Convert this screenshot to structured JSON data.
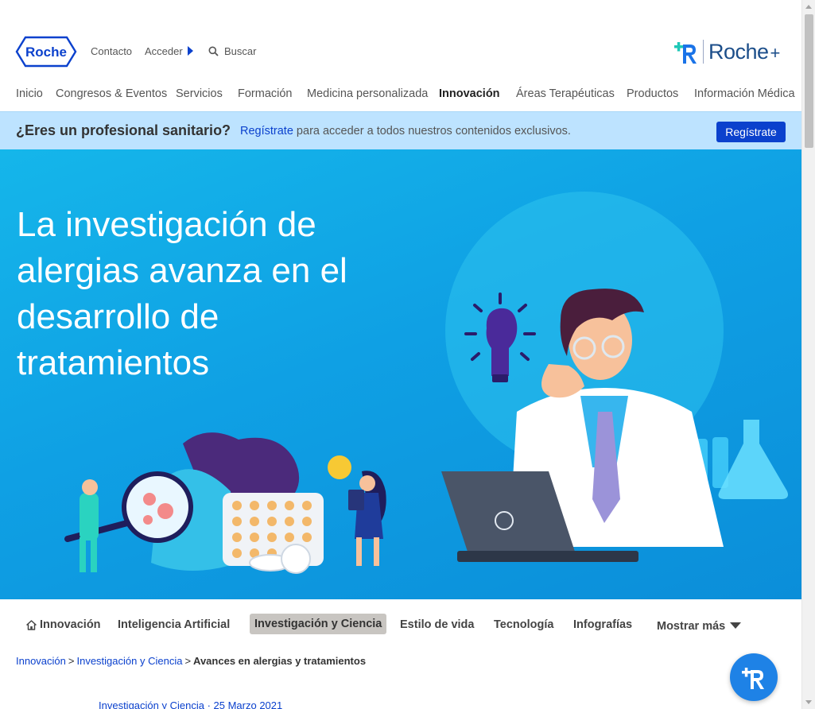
{
  "header": {
    "logo_text": "Roche",
    "contacto": "Contacto",
    "acceder": "Acceder",
    "search_label": "Buscar",
    "rocheplus_word": "Roche",
    "rocheplus_plus": "+"
  },
  "nav": {
    "items": [
      {
        "label": "Inicio",
        "active": false
      },
      {
        "label": "Congresos & Eventos",
        "active": false
      },
      {
        "label": "Servicios",
        "active": false
      },
      {
        "label": "Formación",
        "active": false
      },
      {
        "label": "Medicina personalizada",
        "active": false
      },
      {
        "label": "Innovación",
        "active": true
      },
      {
        "label": "Áreas Terapéuticas",
        "active": false
      },
      {
        "label": "Productos",
        "active": false
      },
      {
        "label": "Información Médica",
        "active": false
      }
    ]
  },
  "pro_banner": {
    "question": "¿Eres un profesional sanitario?",
    "link_text": "Regístrate",
    "rest_text": " para acceder a todos nuestros contenidos exclusivos.",
    "button_label": "Regístrate"
  },
  "hero": {
    "title": "La investigación de alergias avanza en el desarrollo de tratamientos"
  },
  "subnav": {
    "home_label": "Innovación",
    "items": [
      "Inteligencia Artificial",
      "Investigación y Ciencia",
      "Estilo de vida",
      "Tecnología",
      "Infografías"
    ],
    "active": "Investigación y Ciencia",
    "more_label": "Mostrar más"
  },
  "breadcrumb": {
    "items": [
      "Innovación",
      "Investigación y Ciencia"
    ],
    "separator": ">",
    "current": "Avances en alergias y tratamientos"
  },
  "article_meta": {
    "text": "Investigación y Ciencia · 25 Marzo 2021"
  },
  "colors": {
    "brand_blue": "#0b41cd",
    "banner_bg": "#bde3ff",
    "hero_bg": "#0fa0e4",
    "fab_bg": "#1e82e6"
  }
}
